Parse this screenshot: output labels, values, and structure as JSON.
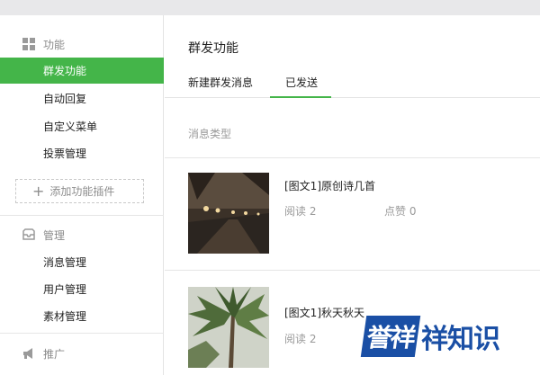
{
  "sidebar": {
    "sections": [
      {
        "title": "功能",
        "icon": "grid-icon"
      },
      {
        "title": "管理",
        "icon": "inbox-icon"
      },
      {
        "title": "推广",
        "icon": "megaphone-icon"
      }
    ],
    "function_items": [
      {
        "label": "群发功能",
        "active": true
      },
      {
        "label": "自动回复",
        "active": false
      },
      {
        "label": "自定义菜单",
        "active": false
      },
      {
        "label": "投票管理",
        "active": false
      }
    ],
    "add_plugin_label": "添加功能插件",
    "manage_items": [
      {
        "label": "消息管理"
      },
      {
        "label": "用户管理"
      },
      {
        "label": "素材管理"
      }
    ]
  },
  "main": {
    "title": "群发功能",
    "tabs": [
      {
        "label": "新建群发消息",
        "active": false
      },
      {
        "label": "已发送",
        "active": true
      }
    ],
    "filter_label": "消息类型",
    "messages": [
      {
        "title": "[图文1]原创诗几首",
        "reads": "阅读 2",
        "likes": "点赞 0"
      },
      {
        "title": "[图文1]秋天秋天",
        "reads": "阅读 2",
        "likes": ""
      }
    ]
  },
  "watermark": {
    "mark": "誉祥",
    "text": "祥知识"
  },
  "colors": {
    "accent": "#44b549",
    "topbar": "#e8e8ea",
    "watermark": "#1a4fa5"
  }
}
